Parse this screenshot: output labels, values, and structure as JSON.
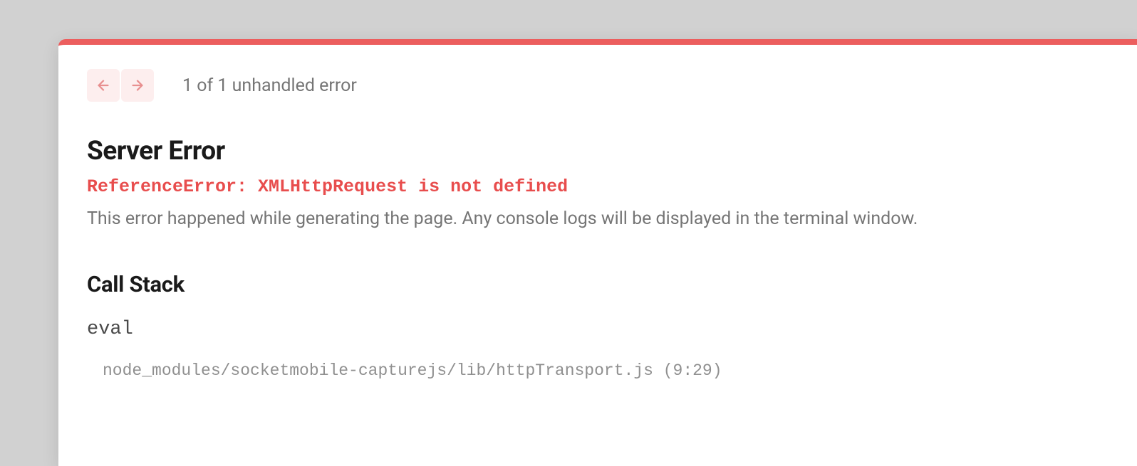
{
  "nav": {
    "counter": "1 of 1 unhandled error"
  },
  "error": {
    "title": "Server Error",
    "message": "ReferenceError: XMLHttpRequest is not defined",
    "description": "This error happened while generating the page. Any console logs will be displayed in the terminal window."
  },
  "callstack": {
    "title": "Call Stack",
    "frames": [
      {
        "function": "eval",
        "location": "node_modules/socketmobile-capturejs/lib/httpTransport.js (9:29)"
      }
    ]
  },
  "colors": {
    "accent_border": "#ec5e5e",
    "nav_bg": "#fdeeee",
    "error_text": "#e84d4d"
  }
}
